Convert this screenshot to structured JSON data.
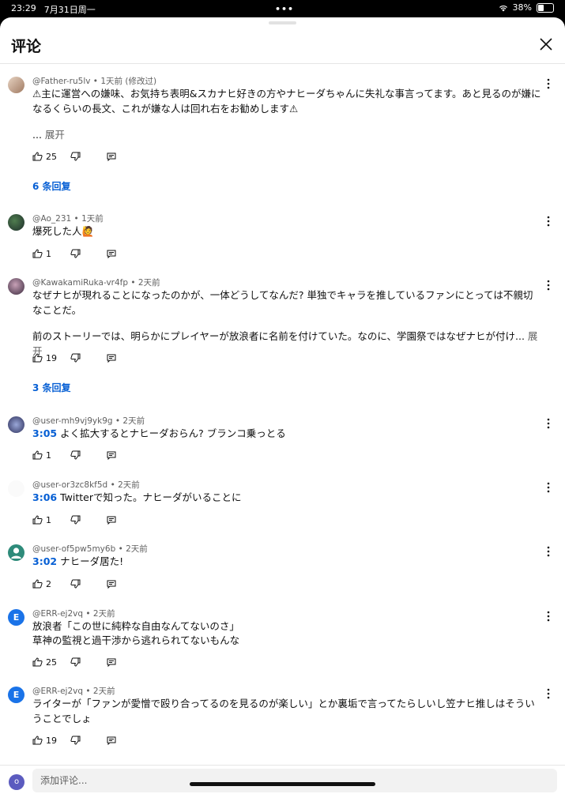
{
  "status_bar": {
    "time": "23:29",
    "date": "7月31日周一",
    "battery": "38%",
    "battery_level": 0.38
  },
  "header": {
    "title": "评论"
  },
  "comments": [
    {
      "author": "@Father-ru5lv",
      "time": "1天前 (修改过)",
      "text": "⚠主に運営への嫌味、お気持ち表明&スカナヒ好きの方やナヒーダちゃんに失礼な事言ってます。あと見るのが嫌になるくらいの長文、これが嫌な人は回れ右をお勧めします⚠",
      "text2": "...",
      "expand": "展开",
      "likes": "25",
      "replies": "6 条回复"
    },
    {
      "author": "@Ao_231",
      "time": "1天前",
      "text": "爆死した人🙋",
      "likes": "1"
    },
    {
      "author": "@KawakamiRuka-vr4fp",
      "time": "2天前",
      "text": "なぜナヒが現れることになったのかが、一体どうしてなんだ? 単独でキャラを推しているファンにとっては不親切なことだ。",
      "text2": "前のストーリーでは、明らかにプレイヤーが放浪者に名前を付けていた。なのに、学園祭ではなぜナヒが付け...",
      "expand": "展开",
      "likes": "19",
      "replies": "3 条回复"
    },
    {
      "author": "@user-mh9vj9yk9g",
      "time": "2天前",
      "timestamp": "3:05",
      "text": "よく拡大するとナヒーダおらん? ブランコ乗っとる",
      "likes": "1"
    },
    {
      "author": "@user-or3zc8kf5d",
      "time": "2天前",
      "timestamp": "3:06",
      "text": "Twitterで知った。ナヒーダがいることに",
      "likes": "1"
    },
    {
      "author": "@user-of5pw5my6b",
      "time": "2天前",
      "timestamp": "3:02",
      "text": "ナヒーダ居た!",
      "likes": "2"
    },
    {
      "author": "@ERR-ej2vq",
      "avatar_letter": "E",
      "time": "2天前",
      "text": "放浪者「この世に純粋な自由なんてないのさ」",
      "text2": "草神の監視と過干渉から逃れられてないもんな",
      "likes": "25"
    },
    {
      "author": "@ERR-ej2vq",
      "avatar_letter": "E",
      "time": "2天前",
      "text": "ライターが「ファンが愛憎で殴り合ってるのを見るのが楽しい」とか裏垢で言ってたらしいし笠ナヒ推しはそういうことでしょ",
      "likes": "19"
    }
  ],
  "add_comment": {
    "avatar_letter": "o",
    "placeholder": "添加评论..."
  },
  "colors": {
    "link": "#065fd4",
    "meta": "#606060",
    "accent_avatar": "#1a73e8"
  },
  "icons": [
    "close-icon",
    "like-icon",
    "dislike-icon",
    "reply-icon",
    "more-vert-icon",
    "wifi-icon",
    "battery-icon"
  ]
}
